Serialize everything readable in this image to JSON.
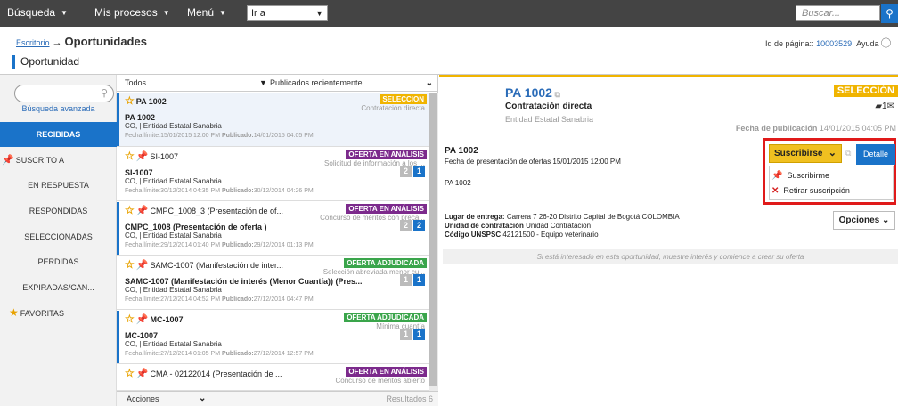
{
  "topnav": {
    "busqueda": "Búsqueda",
    "mis_procesos": "Mis procesos",
    "menu": "Menú",
    "ir_a": "Ir a",
    "search_placeholder": "Buscar..."
  },
  "breadcrumb": {
    "home": "Escritorio",
    "arrow": "→",
    "current": "Oportunidades"
  },
  "page_id": {
    "label": "Id de página::",
    "value": "10003529",
    "help": "Ayuda"
  },
  "page_title": "Oportunidad",
  "sidebar": {
    "advanced_search": "Búsqueda avanzada",
    "items": [
      {
        "label": "RECIBIDAS"
      },
      {
        "label": "SUSCRITO A"
      },
      {
        "label": "EN RESPUESTA"
      },
      {
        "label": "RESPONDIDAS"
      },
      {
        "label": "SELECCIONADAS"
      },
      {
        "label": "PERDIDAS"
      },
      {
        "label": "EXPIRADAS/CAN..."
      },
      {
        "label": "FAVORITAS"
      }
    ]
  },
  "list": {
    "filter": "Todos",
    "sort": "Publicados recientemente",
    "footer_actions": "Acciones",
    "footer_results": "Resultados",
    "results_count": "6",
    "fecha_limite_label": "Fecha límite:",
    "publicado_label": "Publicado:",
    "cards": [
      {
        "num": "PA 1002",
        "badge": "SELECCION",
        "type": "Contratación directa",
        "title": "PA 1002",
        "entity": "CO, | Entidad Estatal Sanabria",
        "fl": "15/01/2015 12:00 PM",
        "pub": "14/01/2015 04:05 PM"
      },
      {
        "num": "SI-1007",
        "badge": "OFERTA EN ANÁLISIS",
        "type": "Solicitud de información a los ...",
        "title": "SI-1007",
        "entity": "CO, | Entidad Estatal Sanabria",
        "fl": "30/12/2014 04:35 PM",
        "pub": "30/12/2014 04:26 PM",
        "n1": "2",
        "n2": "1"
      },
      {
        "num": "CMPC_1008_3 (Presentación de of...",
        "badge": "OFERTA EN ANÁLISIS",
        "type": "Concurso de méritos con preca...",
        "title": "CMPC_1008 (Presentación de oferta )",
        "entity": "CO, | Entidad Estatal Sanabria",
        "fl": "29/12/2014 01:40 PM",
        "pub": "29/12/2014 01:13 PM",
        "n1": "2",
        "n2": "2"
      },
      {
        "num": "SAMC-1007 (Manifestación de inter...",
        "badge": "OFERTA ADJUDICADA",
        "type": "Selección abreviada menor cu...",
        "title": "SAMC-1007 (Manifestación de interés (Menor Cuantía)) (Pres...",
        "entity": "CO, | Entidad Estatal Sanabria",
        "fl": "27/12/2014 04:52 PM",
        "pub": "27/12/2014 04:47 PM",
        "n1": "1",
        "n2": "1"
      },
      {
        "num": "MC-1007",
        "badge": "OFERTA ADJUDICADA",
        "type": "Mínima cuantía",
        "title": "MC-1007",
        "entity": "CO, | Entidad Estatal Sanabria",
        "fl": "27/12/2014 01:05 PM",
        "pub": "27/12/2014 12:57 PM",
        "n1": "1",
        "n2": "1"
      },
      {
        "num": "CMA - 02122014 (Presentación de ...",
        "badge": "OFERTA EN ANÁLISIS",
        "type": "Concurso de méritos abierto"
      }
    ]
  },
  "detail": {
    "num": "PA 1002",
    "modality": "Contratación directa",
    "entity": "Entidad Estatal Sanabria",
    "badge": "SELECCIÓN",
    "doc_count": "1",
    "pub_label": "Fecha de publicación",
    "pub_date": "14/01/2015 04:05 PM",
    "title": "PA 1002",
    "fecha_presentacion": "Fecha de presentación de ofertas 15/01/2015 12:00 PM",
    "desc": "PA 1002",
    "lugar_label": "Lugar de entrega:",
    "lugar_value": "Carrera 7 26-20 Distrito Capital de Bogotá COLOMBIA",
    "unidad_label": "Unidad de contratación",
    "unidad_value": "Unidad Contratacion",
    "codigo_label": "Código UNSPSC",
    "codigo_value": "42121500 - Equipo veterinario",
    "subscribe_btn": "Suscribirse",
    "detail_btn": "Detalle",
    "menu_subscribe": "Suscribirme",
    "menu_unsubscribe": "Retirar suscripción",
    "options_btn": "Opciones",
    "interest_msg": "Si está interesado en esta oportunidad, muestre interés y comience a crear su oferta"
  },
  "colors": {
    "accent": "#1a73c9",
    "topbar": "#444444",
    "gold": "#f0b400",
    "purple": "#7c2a8c",
    "green": "#3aa54b",
    "highlight": "#e01a1a"
  }
}
